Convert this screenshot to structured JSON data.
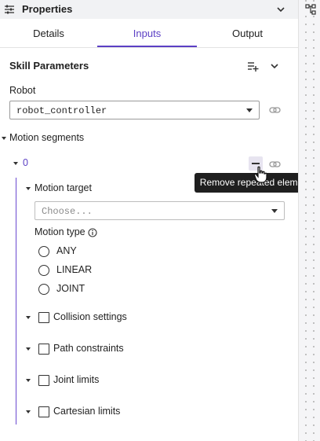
{
  "header": {
    "title": "Properties"
  },
  "tabs": [
    {
      "label": "Details",
      "active": false
    },
    {
      "label": "Inputs",
      "active": true
    },
    {
      "label": "Output",
      "active": false
    }
  ],
  "accent_color": "#5b3fc4",
  "skill_parameters": {
    "title": "Skill Parameters",
    "robot": {
      "label": "Robot",
      "value": "robot_controller"
    },
    "motion_segments": {
      "label": "Motion segments",
      "items": [
        {
          "index": "0",
          "motion_target": {
            "label": "Motion target",
            "placeholder": "Choose..."
          },
          "motion_type": {
            "label": "Motion type",
            "options": [
              "ANY",
              "LINEAR",
              "JOINT"
            ]
          },
          "sections": [
            {
              "label": "Collision settings"
            },
            {
              "label": "Path constraints"
            },
            {
              "label": "Joint limits"
            },
            {
              "label": "Cartesian limits"
            }
          ]
        }
      ]
    }
  },
  "tooltip": {
    "text": "Remove repeated element"
  },
  "icons": {
    "header": "properties-sliders-icon",
    "collapse": "chevron-down-icon",
    "add": "playlist-add-icon",
    "link": "link-add-icon",
    "info": "info-icon",
    "remove": "minus-icon",
    "strip": "node-tree-icon"
  }
}
